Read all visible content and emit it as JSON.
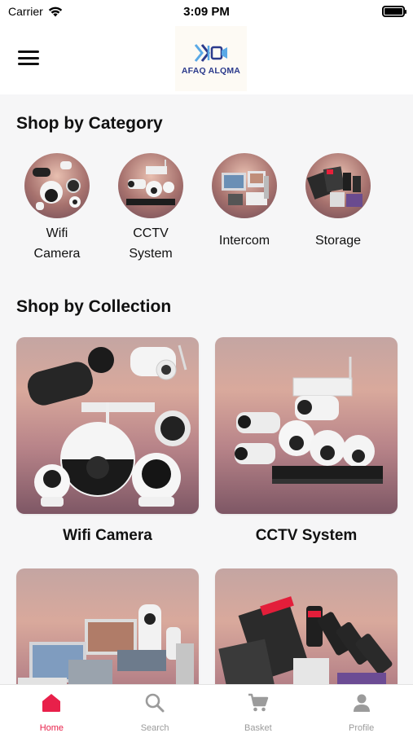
{
  "status_bar": {
    "carrier": "Carrier",
    "time": "3:09 PM"
  },
  "header": {
    "logo_text": "AFAQ ALQMA",
    "menu_icon": "hamburger-icon"
  },
  "categories_section": {
    "title": "Shop by Category",
    "items": [
      {
        "label_line1": "Wifi",
        "label_line2": "Camera"
      },
      {
        "label_line1": "CCTV",
        "label_line2": "System"
      },
      {
        "label_line1": "Intercom",
        "label_line2": ""
      },
      {
        "label_line1": "Storage",
        "label_line2": ""
      }
    ]
  },
  "collections_section": {
    "title": "Shop by Collection",
    "items": [
      {
        "label": "Wifi Camera"
      },
      {
        "label": "CCTV System"
      },
      {
        "label": ""
      },
      {
        "label": ""
      }
    ]
  },
  "bottom_nav": {
    "items": [
      {
        "label": "Home",
        "icon": "home-icon",
        "active": true
      },
      {
        "label": "Search",
        "icon": "search-icon",
        "active": false
      },
      {
        "label": "Basket",
        "icon": "cart-icon",
        "active": false
      },
      {
        "label": "Profile",
        "icon": "profile-icon",
        "active": false
      }
    ]
  },
  "colors": {
    "accent": "#e8204a",
    "inactive": "#9b9b9b",
    "background": "#f6f6f7"
  }
}
